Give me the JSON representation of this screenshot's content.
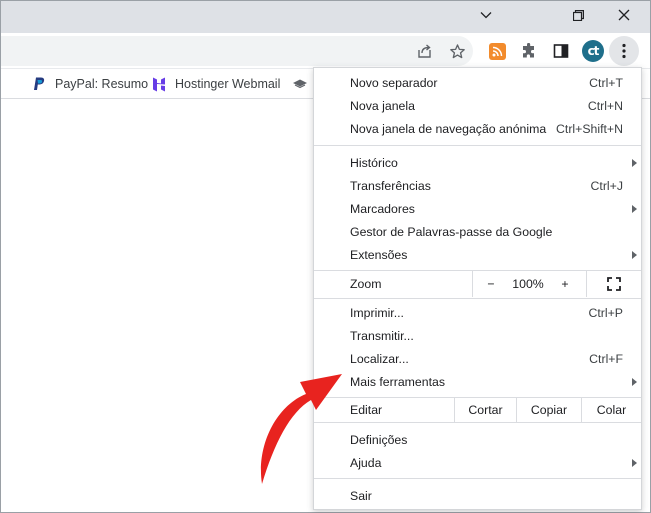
{
  "window": {
    "controls": [
      "chevron-down-icon",
      "restore-icon",
      "close-icon"
    ]
  },
  "toolbar": {
    "icons": [
      "share-icon",
      "star-icon",
      "rss-extension-icon",
      "puzzle-extensions-icon",
      "side-panel-icon",
      "profile-avatar",
      "kebab-menu-icon"
    ],
    "avatar_text": "ct",
    "rss_color": "#f28b2c",
    "avatar_color": "#1f6f8b"
  },
  "bookmarks": [
    {
      "label": "PayPal: Resumo",
      "icon": "paypal-icon"
    },
    {
      "label": "Hostinger Webmail",
      "icon": "hostinger-icon"
    }
  ],
  "menu": {
    "group1": [
      {
        "label": "Novo separador",
        "shortcut": "Ctrl+T"
      },
      {
        "label": "Nova janela",
        "shortcut": "Ctrl+N"
      },
      {
        "label": "Nova janela de navegação anónima",
        "shortcut": "Ctrl+Shift+N"
      }
    ],
    "group2": [
      {
        "label": "Histórico",
        "shortcut": "",
        "submenu": true
      },
      {
        "label": "Transferências",
        "shortcut": "Ctrl+J",
        "submenu": false
      },
      {
        "label": "Marcadores",
        "shortcut": "",
        "submenu": true
      },
      {
        "label": "Gestor de Palavras-passe da Google",
        "shortcut": "",
        "submenu": false
      },
      {
        "label": "Extensões",
        "shortcut": "",
        "submenu": true
      }
    ],
    "zoom": {
      "label": "Zoom",
      "minus": "−",
      "value": "100%",
      "plus": "+"
    },
    "group3": [
      {
        "label": "Imprimir...",
        "shortcut": "Ctrl+P",
        "submenu": false
      },
      {
        "label": "Transmitir...",
        "shortcut": "",
        "submenu": false
      },
      {
        "label": "Localizar...",
        "shortcut": "Ctrl+F",
        "submenu": false
      },
      {
        "label": "Mais ferramentas",
        "shortcut": "",
        "submenu": true
      }
    ],
    "edit": {
      "label": "Editar",
      "cut": "Cortar",
      "copy": "Copiar",
      "paste": "Colar"
    },
    "group4": [
      {
        "label": "Definições",
        "submenu": false
      },
      {
        "label": "Ajuda",
        "submenu": true
      }
    ],
    "exit": {
      "label": "Sair"
    }
  },
  "annotation": {
    "arrow_color": "#e8231f"
  }
}
